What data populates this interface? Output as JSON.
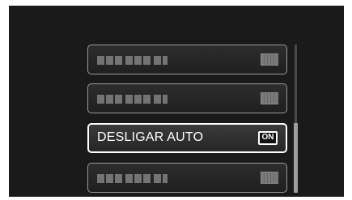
{
  "menu": {
    "items": [
      {
        "label": "",
        "value": "",
        "state": "disabled"
      },
      {
        "label": "",
        "value": "",
        "state": "disabled"
      },
      {
        "label": "DESLIGAR AUTO",
        "value": "ON",
        "state": "selected"
      },
      {
        "label": "",
        "value": "",
        "state": "disabled"
      }
    ]
  },
  "scroll": {
    "position": "bottom"
  },
  "colors": {
    "screen_background": "#1a1a1a",
    "item_border": "#9a9a9a",
    "selected_border": "#ffffff"
  }
}
